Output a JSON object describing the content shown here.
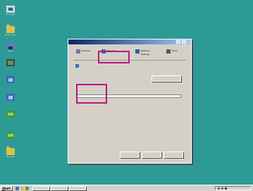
{
  "desktop": {
    "background": "#2e9a96",
    "icons": [
      {
        "name": "my-computer-icon",
        "label": "My Computer"
      },
      {
        "name": "my-documents-icon",
        "label": "My Documents"
      },
      {
        "name": "network-icon",
        "label": "Network"
      },
      {
        "name": "program-icon",
        "label": ""
      },
      {
        "name": "app-icon",
        "label": ""
      },
      {
        "name": "app2-icon",
        "label": ""
      },
      {
        "name": "app3-icon",
        "label": ""
      },
      {
        "name": "app4-icon",
        "label": ""
      },
      {
        "name": "recycle-bin-icon",
        "label": "Recycle Bin"
      }
    ]
  },
  "dialog": {
    "title": "",
    "toolbar": [
      {
        "label": "General",
        "sub": ""
      },
      {
        "label": "Sharing",
        "sub": ""
      },
      {
        "label": "Network",
        "sub": "Settings"
      },
      {
        "label": "Tools",
        "sub": ""
      }
    ],
    "section_label": "",
    "info_line_1": "",
    "info_line_2": "",
    "settings_button": "",
    "group_label": "",
    "field_label": "",
    "field_value": "",
    "footer_text": "",
    "buttons": {
      "ok": "",
      "cancel": "",
      "apply": ""
    },
    "highlight_color": "#c0137a"
  },
  "taskbar": {
    "start_label": "Start",
    "clock": ""
  }
}
